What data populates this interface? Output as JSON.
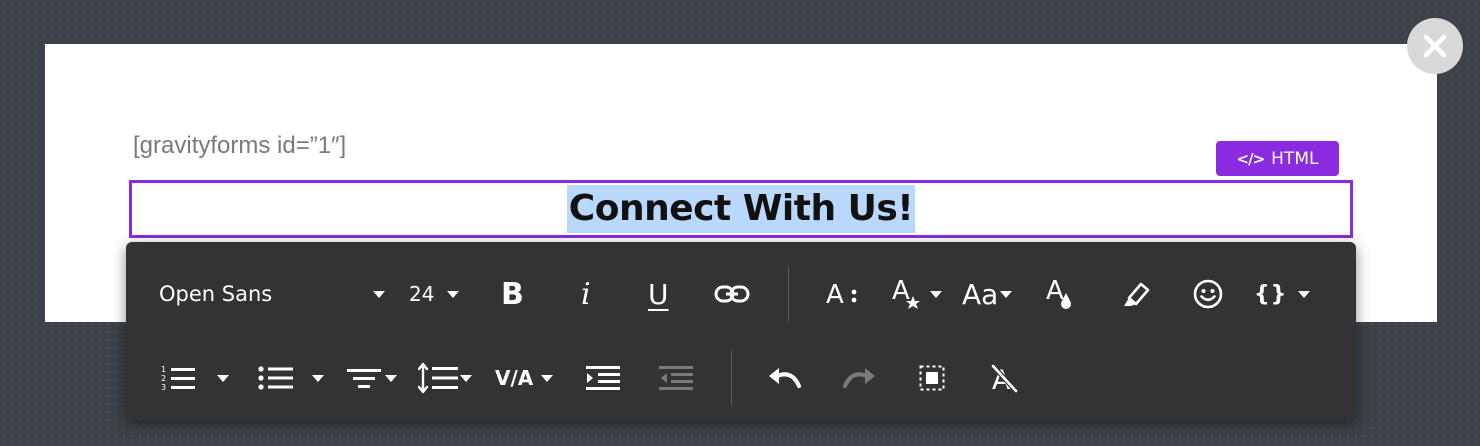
{
  "canvas": {
    "shortcode_text": "[gravityforms id=”1″]",
    "heading_text": "Connect With Us!"
  },
  "html_badge": {
    "code_glyph": "</>",
    "label": "HTML"
  },
  "toolbar": {
    "font_family_value": "Open Sans",
    "font_size_value": "24",
    "bold_label": "B",
    "italic_label": "i",
    "underline_label": "U",
    "text_case_label": "Aa",
    "code_label": "{}",
    "letter_spacing_label": "V/A"
  },
  "icons": [
    "close-icon",
    "code-icon",
    "caret-down-icon",
    "link-icon",
    "font-size-icon",
    "text-style-icon",
    "text-color-icon",
    "highlighter-icon",
    "emoji-icon",
    "ordered-list-icon",
    "unordered-list-icon",
    "align-icon",
    "line-height-icon",
    "indent-icon",
    "outdent-icon",
    "undo-icon",
    "redo-icon",
    "select-all-icon",
    "clear-formatting-icon"
  ],
  "colors": {
    "accent": "#8a2be2",
    "selection": "#b9d8fb",
    "toolbar_bg": "#333333",
    "backdrop": "#3d4248"
  }
}
